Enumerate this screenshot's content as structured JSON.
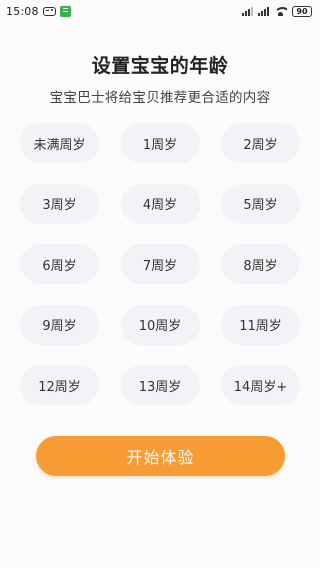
{
  "status_bar": {
    "time": "15:08",
    "battery": "90",
    "icons": [
      "game-controller-icon",
      "notification-icon",
      "signal-icon",
      "signal-icon",
      "wifi-icon",
      "battery-icon"
    ]
  },
  "header": {
    "title": "设置宝宝的年龄",
    "subtitle": "宝宝巴士将给宝贝推荐更合适的内容"
  },
  "ages": [
    {
      "label": "未满周岁"
    },
    {
      "label": "1周岁"
    },
    {
      "label": "2周岁"
    },
    {
      "label": "3周岁"
    },
    {
      "label": "4周岁"
    },
    {
      "label": "5周岁"
    },
    {
      "label": "6周岁"
    },
    {
      "label": "7周岁"
    },
    {
      "label": "8周岁"
    },
    {
      "label": "9周岁"
    },
    {
      "label": "10周岁"
    },
    {
      "label": "11周岁"
    },
    {
      "label": "12周岁"
    },
    {
      "label": "13周岁"
    },
    {
      "label": "14周岁+"
    }
  ],
  "start_button": {
    "label": "开始体验"
  },
  "colors": {
    "accent": "#f79c35",
    "chip_background": "#f1f3f6",
    "page_background": "#fbfbfb"
  }
}
